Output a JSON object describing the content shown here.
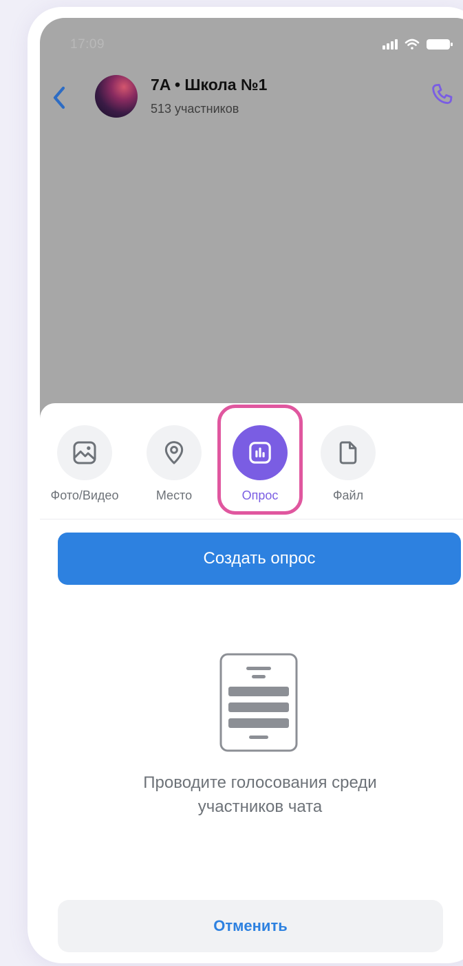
{
  "status_bar": {
    "time": "17:09",
    "icons": [
      "signal-icon",
      "wifi-icon",
      "battery-icon"
    ]
  },
  "header": {
    "back_icon": "back-chevron-icon",
    "title": "7A • Школа №1",
    "subtitle": "513 участников",
    "call_icon": "phone-icon"
  },
  "attach_options": [
    {
      "label": "Фото/Видео",
      "icon": "image-icon",
      "active": false
    },
    {
      "label": "Место",
      "icon": "location-pin-icon",
      "active": false
    },
    {
      "label": "Опрос",
      "icon": "poll-icon",
      "active": true
    },
    {
      "label": "Файл",
      "icon": "file-icon",
      "active": false
    }
  ],
  "primary_action": {
    "label": "Создать опрос"
  },
  "empty_state": {
    "icon": "poll-document-icon",
    "line1": "Проводите голосования среди",
    "line2": "участников чата"
  },
  "cancel": {
    "label": "Отменить"
  },
  "colors": {
    "accent_blue": "#2d81e0",
    "accent_purple": "#7a5de3",
    "highlight_pink": "#e0579f",
    "overlay_gray": "#a7a7a7"
  }
}
